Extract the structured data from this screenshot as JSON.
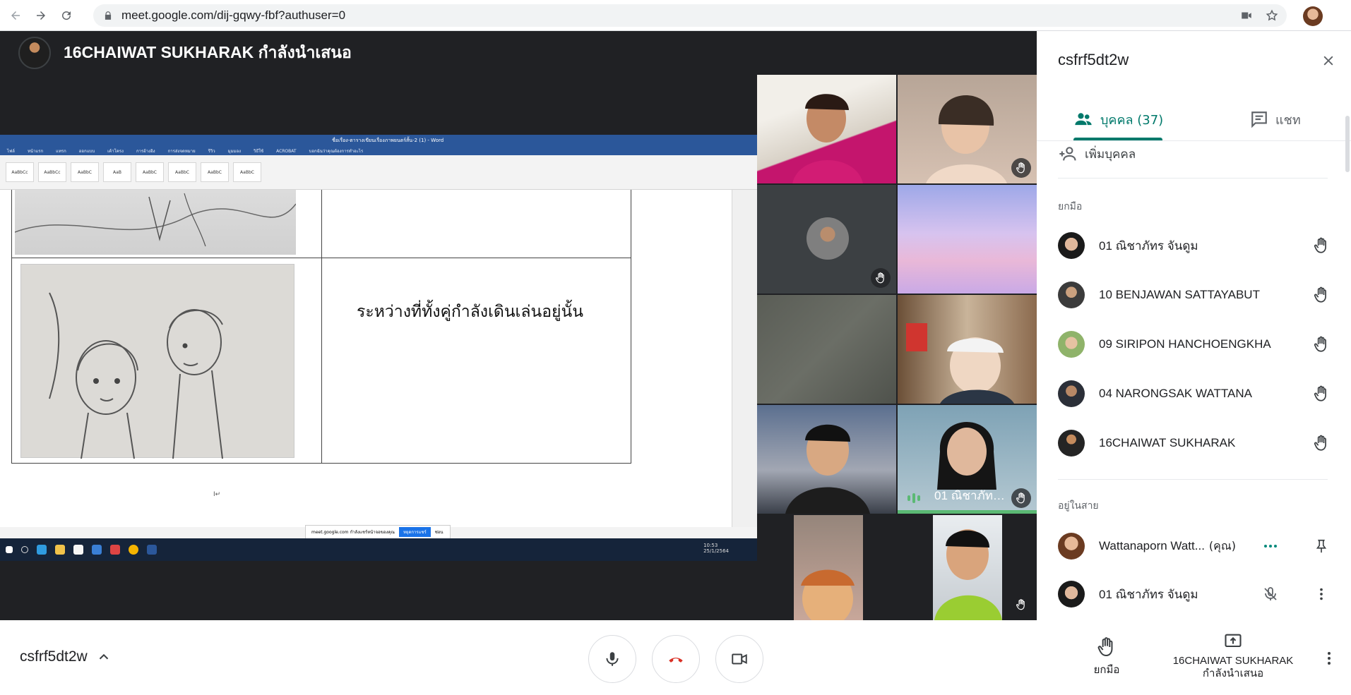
{
  "browser": {
    "url": "meet.google.com/dij-gqwy-fbf?authuser=0"
  },
  "stage": {
    "presenter_name": "16CHAIWAT SUKHARAK กำลังนำเสนอ",
    "doc_title": "ชื่อเรื่อง-ตารางเขียนเรื่องภาพยนตร์สั้น-2 (1) - Word",
    "doc_tabs": [
      "ไฟล์",
      "หน้าแรก",
      "แทรก",
      "ออกแบบ",
      "เค้าโครง",
      "การอ้างอิง",
      "การส่งจดหมาย",
      "รีวิว",
      "มุมมอง",
      "วิธีใช้",
      "ACROBAT",
      "บอกฉันว่าคุณต้องการทำอะไร"
    ],
    "doc_text": "ระหว่างที่ทั้งคู่กำลังเดินเล่นอยู่นั้น",
    "share_toast_text": "meet.google.com กำลังแชร์หน้าจอของคุณ",
    "share_toast_stop": "หยุดการแชร์",
    "share_toast_hide": "ซ่อน",
    "taskbar_time": "10:53",
    "taskbar_date": "25/1/2564"
  },
  "tiles": {
    "speaking_name": "01 ณิชาภัทร จันดูม"
  },
  "panel": {
    "meeting_code": "csfrf5dt2w",
    "tab_people": "บุคคล (37)",
    "tab_chat": "แชท",
    "add_people": "เพิ่มบุคคล",
    "section_raised": "ยกมือ",
    "section_incall": "อยู่ในสาย",
    "raised": [
      {
        "name": "01 ณิชาภัทร จันดูม"
      },
      {
        "name": "10 BENJAWAN SATTAYABUT"
      },
      {
        "name": "09 SIRIPON HANCHOENGKHA"
      },
      {
        "name": "04 NARONGSAK WATTANA"
      },
      {
        "name": "16CHAIWAT SUKHARAK"
      }
    ],
    "incall": [
      {
        "name": "Wattanaporn Watt...",
        "suffix": "(คุณ)"
      },
      {
        "name": "01 ณิชาภัทร จันดูม"
      }
    ]
  },
  "bottom": {
    "meeting_code": "csfrf5dt2w",
    "raise_hand_label": "ยกมือ",
    "present_label_line1": "16CHAIWAT SUKHARAK",
    "present_label_line2": "กำลังนำเสนอ"
  },
  "colors": {
    "accent": "#00796b",
    "speaking": "#5bb974",
    "end_call": "#d93025"
  }
}
